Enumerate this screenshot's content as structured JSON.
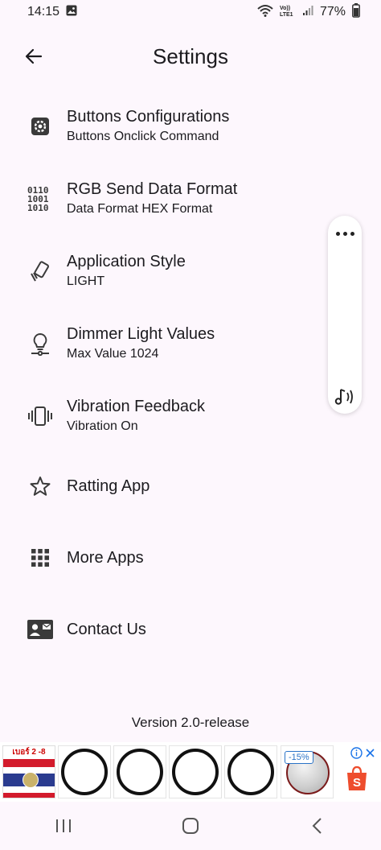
{
  "status_bar": {
    "time": "14:15",
    "network": "Vo)) LTE1",
    "battery": "77%"
  },
  "app_bar": {
    "title": "Settings",
    "back_icon": "arrow-back-icon"
  },
  "menu": [
    {
      "title": "Buttons Configurations",
      "subtitle": "Buttons Onclick Command",
      "icon": "gear-icon"
    },
    {
      "title": "RGB Send Data Format",
      "subtitle": "Data Format HEX Format",
      "icon": "binary-icon",
      "icon_text": [
        "0110",
        "1001",
        "1010"
      ]
    },
    {
      "title": "Application Style",
      "subtitle": "LIGHT",
      "icon": "screen-rotation-icon"
    },
    {
      "title": "Dimmer Light Values",
      "subtitle": "Max Value 1024",
      "icon": "lightbulb-icon"
    },
    {
      "title": "Vibration Feedback",
      "subtitle": "Vibration On",
      "icon": "vibration-icon"
    },
    {
      "title": "Ratting App",
      "subtitle": "",
      "icon": "star-icon"
    },
    {
      "title": "More Apps",
      "subtitle": "",
      "icon": "apps-grid-icon"
    },
    {
      "title": "Contact Us",
      "subtitle": "",
      "icon": "contact-card-icon"
    }
  ],
  "floating_panel": {
    "more_icon": "more-horizontal-icon",
    "sound_icon": "music-note-sound-icon"
  },
  "version": "Version 2.0-release",
  "ad": {
    "flag_label": "เบอร์ 2 -8",
    "discount": "-15%",
    "shop_icon": "shopping-bag-icon",
    "colors": {
      "flag_red": "#d31b2c",
      "flag_blue": "#2a3b8f",
      "shop_orange": "#ee4d2d"
    }
  },
  "nav_bar": {
    "recents_icon": "recents-icon",
    "home_icon": "home-icon",
    "back_icon": "nav-back-icon"
  },
  "colors": {
    "background": "#fdf7fd",
    "text": "#1c1b1f",
    "icon": "#3a3a3a"
  }
}
